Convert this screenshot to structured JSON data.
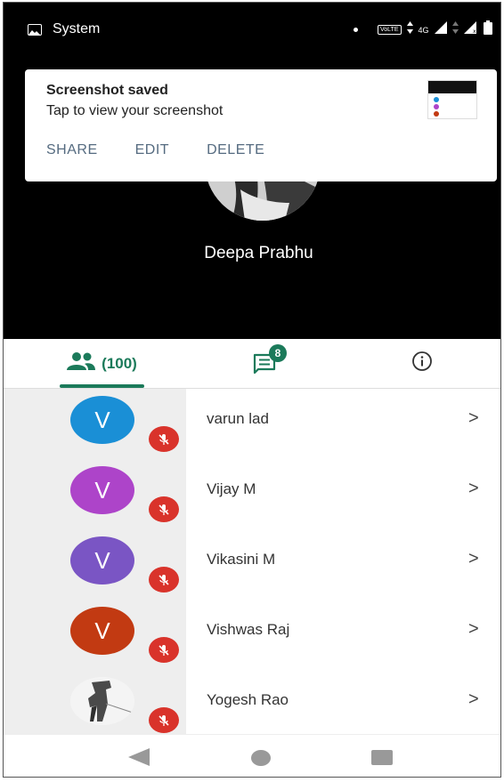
{
  "status_bar": {
    "app_name": "System",
    "volte": "VoLTE",
    "network": "4G"
  },
  "notification": {
    "title": "Screenshot saved",
    "subtitle": "Tap to view your screenshot",
    "actions": [
      "SHARE",
      "EDIT",
      "DELETE"
    ]
  },
  "host": {
    "name": "Deepa Prabhu"
  },
  "tabs": {
    "participants_count": "(100)",
    "chat_badge": "8"
  },
  "participants": [
    {
      "name": "varun lad",
      "initial": "V",
      "avatar_color": "#1a8fd6",
      "muted": true
    },
    {
      "name": "Vijay M",
      "initial": "V",
      "avatar_color": "#ad44c9",
      "muted": true
    },
    {
      "name": "Vikasini M",
      "initial": "V",
      "avatar_color": "#7a55c4",
      "muted": true
    },
    {
      "name": "Vishwas Raj",
      "initial": "V",
      "avatar_color": "#c23a12",
      "muted": true
    },
    {
      "name": "Yogesh Rao",
      "initial": "",
      "avatar_color": "photo",
      "muted": true
    }
  ],
  "chevron": ">",
  "colors": {
    "accent": "#1b7a5a",
    "mute_red": "#d9332b"
  }
}
